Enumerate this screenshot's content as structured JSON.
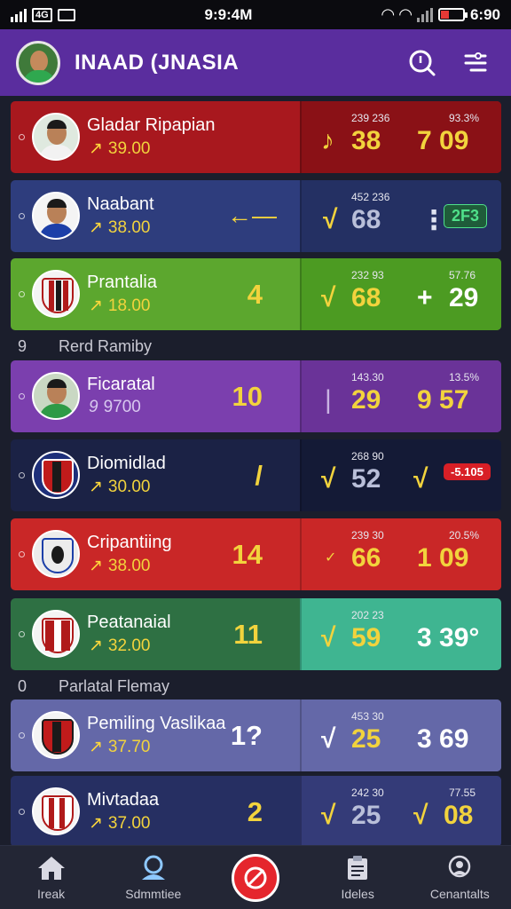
{
  "status_bar": {
    "time": "9:9:4M",
    "battery": "6:90",
    "carrier_box": "4G",
    "box2": ""
  },
  "header": {
    "title": "INAAD (JNASIA"
  },
  "sections": [
    "Rerd Ramiby",
    "Parlatal Flemay"
  ],
  "rows": [
    {
      "name": "Gladar Ripapian",
      "price": "39.00",
      "stat_a_label": "239 236",
      "stat_a": "38",
      "stat_b_label": "93.3%",
      "stat_b": "7 09",
      "big": ""
    },
    {
      "name": "Naabant",
      "price": "38.00",
      "stat_a_label": "452 236",
      "stat_a": "68",
      "stat_b_label": "",
      "stat_b": "",
      "big": "",
      "badge": "2F3"
    },
    {
      "name": "Prantalia",
      "price": "18.00",
      "stat_a_label": "232 93",
      "stat_a": "68",
      "stat_b_label": "57.76",
      "stat_b": "29",
      "big": "4"
    },
    {
      "name": "Ficaratal",
      "price": "9700",
      "stat_a_label": "143.30",
      "stat_a": "29",
      "stat_b_label": "13.5%",
      "stat_b": "9 57",
      "big": "10"
    },
    {
      "name": "Diomidlad",
      "price": "30.00",
      "stat_a_label": "268 90",
      "stat_a": "52",
      "stat_b_label": "",
      "stat_b": "",
      "big": "/",
      "badge": "-5.105"
    },
    {
      "name": "Cripantiing",
      "price": "38.00",
      "stat_a_label": "239 30",
      "stat_a": "66",
      "stat_b_label": "20.5%",
      "stat_b": "1 09",
      "big": "14"
    },
    {
      "name": "Peatanaial",
      "price": "32.00",
      "stat_a_label": "202 23",
      "stat_a": "59",
      "stat_b_label": "",
      "stat_b": "3 39°",
      "big": "11"
    },
    {
      "name": "Pemiling Vaslikaa",
      "price": "37.70",
      "stat_a_label": "453 30",
      "stat_a": "25",
      "stat_b_label": "",
      "stat_b": "3 69",
      "big": "1?"
    },
    {
      "name": "Mivtadaa",
      "price": "37.00",
      "stat_a_label": "242 30",
      "stat_a": "25",
      "stat_b_label": "77.55",
      "stat_b": "08",
      "big": "2"
    }
  ],
  "nav": [
    {
      "label": "Ireak"
    },
    {
      "label": "Sdmmtiee"
    },
    {
      "label": ""
    },
    {
      "label": "Ideles"
    },
    {
      "label": "Cenantalts"
    }
  ],
  "colors": {
    "header": "#5a2d9e",
    "accent_yellow": "#f2d33d",
    "fab": "#e5262d"
  }
}
